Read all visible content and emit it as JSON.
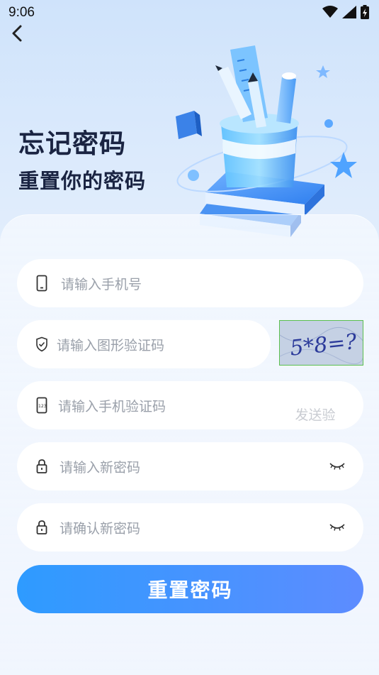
{
  "status_bar": {
    "time": "9:06"
  },
  "header": {
    "title": "忘记密码",
    "subtitle": "重置你的密码"
  },
  "form": {
    "phone_placeholder": "请输入手机号",
    "captcha_placeholder": "请输入图形验证码",
    "captcha_image_text": "5*8=?",
    "sms_placeholder": "请输入手机验证码",
    "send_code_label": "发送验证码",
    "new_password_placeholder": "请输入新密码",
    "confirm_password_placeholder": "请确认新密码",
    "submit_label": "重置密码"
  },
  "colors": {
    "primary_start": "#2e9bff",
    "primary_end": "#5d8cff",
    "title": "#1a2442"
  }
}
